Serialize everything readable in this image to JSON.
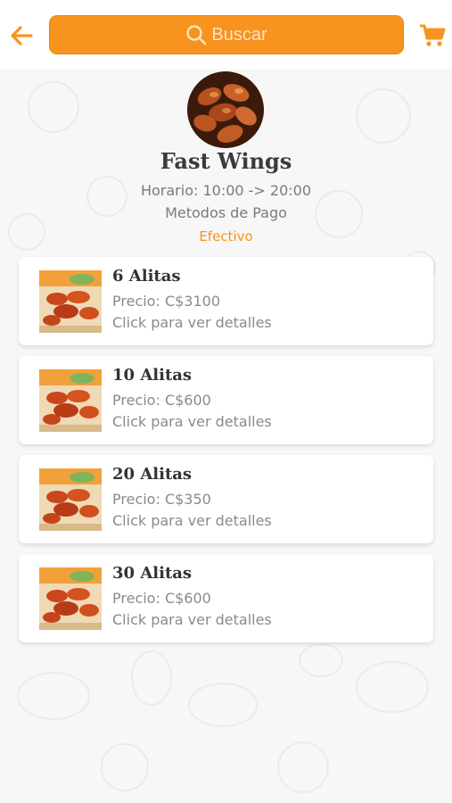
{
  "header": {
    "search_placeholder": "Buscar",
    "accent": "#f7931e",
    "back_icon": "arrow-left-icon",
    "search_icon": "search-icon",
    "cart_icon": "cart-icon"
  },
  "restaurant": {
    "name": "Fast Wings",
    "hours": "Horario: 10:00 -> 20:00",
    "payment_label": "Metodos de Pago",
    "payment_method": "Efectivo"
  },
  "products": [
    {
      "name": "6 Alitas",
      "price": "Precio: C$3100",
      "cta": "Click para ver detalles"
    },
    {
      "name": "10 Alitas",
      "price": "Precio: C$600",
      "cta": "Click para ver detalles"
    },
    {
      "name": "20 Alitas",
      "price": "Precio: C$350",
      "cta": "Click para ver detalles"
    },
    {
      "name": "30 Alitas",
      "price": "Precio: C$600",
      "cta": "Click para ver detalles"
    }
  ]
}
